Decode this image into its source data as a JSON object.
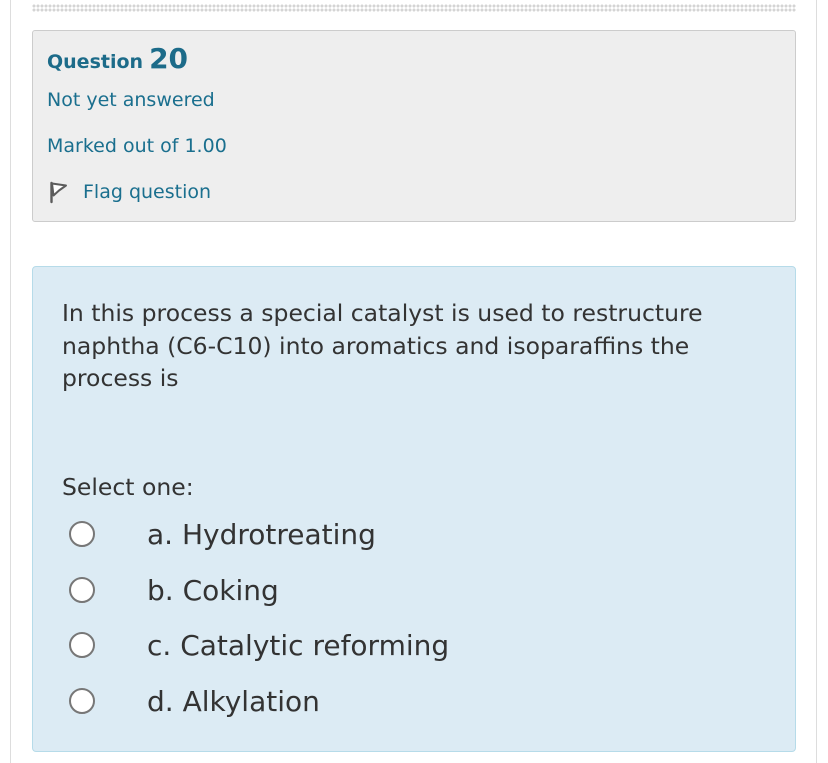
{
  "question": {
    "label": "Question",
    "number": "20",
    "state": "Not yet answered",
    "grade": "Marked out of 1.00",
    "flag": {
      "label": "Flag question",
      "icon": "flag-icon"
    }
  },
  "content": {
    "question_text": "In this process a special catalyst is used to restructure naphtha (C6-C10) into aromatics and isoparaffins the process is",
    "prompt": "Select one:",
    "options": [
      {
        "label": "a.  Hydrotreating",
        "selected": false
      },
      {
        "label": "b. Coking",
        "selected": false
      },
      {
        "label": "c. Catalytic reforming",
        "selected": false
      },
      {
        "label": "d. Alkylation",
        "selected": false
      }
    ]
  },
  "colors": {
    "info_background": "#eeeeee",
    "info_text": "#1a6f8e",
    "formulation_background": "#dcebf4",
    "formulation_border": "#b6dbe9",
    "body_text": "#333333"
  }
}
